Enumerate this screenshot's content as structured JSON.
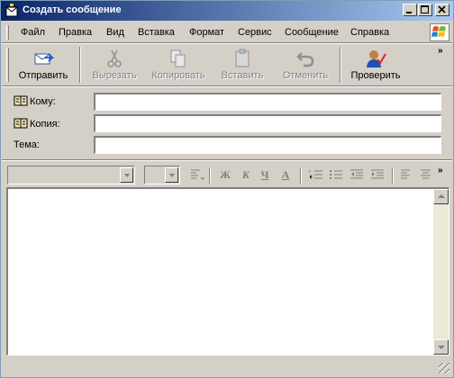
{
  "window": {
    "title": "Создать сообщение"
  },
  "menu": {
    "items": [
      {
        "label": "Файл"
      },
      {
        "label": "Правка"
      },
      {
        "label": "Вид"
      },
      {
        "label": "Вставка"
      },
      {
        "label": "Формат"
      },
      {
        "label": "Сервис"
      },
      {
        "label": "Сообщение"
      },
      {
        "label": "Справка"
      }
    ]
  },
  "toolbar": {
    "send_label": "Отправить",
    "cut_label": "Вырезать",
    "copy_label": "Копировать",
    "paste_label": "Вставить",
    "undo_label": "Отменить",
    "check_label": "Проверить"
  },
  "header": {
    "to_label": "Кому:",
    "cc_label": "Копия:",
    "subject_label": "Тема:",
    "to_value": "",
    "cc_value": "",
    "subject_value": ""
  },
  "format": {
    "font_value": "",
    "size_value": "",
    "bold": "Ж",
    "italic": "К",
    "underline": "Ч",
    "color": "А"
  },
  "body": {
    "text": ""
  },
  "colors": {
    "title_start": "#0a246a",
    "title_end": "#a6caf0",
    "chrome": "#d4d0c8"
  }
}
